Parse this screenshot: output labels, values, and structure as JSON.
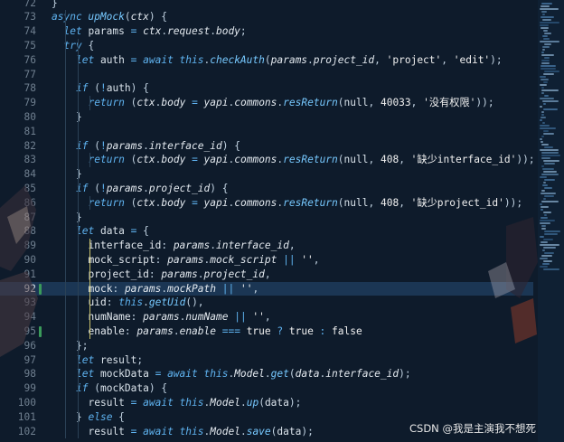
{
  "editor": {
    "current_line": "92",
    "lines": [
      {
        "n": "72",
        "indent": 1,
        "tokens": [
          [
            "pun",
            "}"
          ]
        ]
      },
      {
        "n": "73",
        "indent": 1,
        "tokens": [
          [
            "kw",
            "async "
          ],
          [
            "fn",
            "upMock"
          ],
          [
            "pun",
            "("
          ],
          [
            "var",
            "ctx"
          ],
          [
            "pun",
            ") {"
          ]
        ]
      },
      {
        "n": "74",
        "indent": 2,
        "tokens": [
          [
            "kw",
            "let "
          ],
          [
            "plain",
            "params "
          ],
          [
            "op",
            "= "
          ],
          [
            "var",
            "ctx"
          ],
          [
            "pun",
            "."
          ],
          [
            "var",
            "request"
          ],
          [
            "pun",
            "."
          ],
          [
            "var",
            "body"
          ],
          [
            "pun",
            ";"
          ]
        ]
      },
      {
        "n": "75",
        "indent": 2,
        "tokens": [
          [
            "kw",
            "try "
          ],
          [
            "pun",
            "{"
          ]
        ]
      },
      {
        "n": "76",
        "indent": 3,
        "tokens": [
          [
            "kw",
            "let "
          ],
          [
            "plain",
            "auth "
          ],
          [
            "op",
            "= "
          ],
          [
            "kw",
            "await "
          ],
          [
            "kw",
            "this"
          ],
          [
            "pun",
            "."
          ],
          [
            "fn",
            "checkAuth"
          ],
          [
            "pun",
            "("
          ],
          [
            "var",
            "params"
          ],
          [
            "pun",
            "."
          ],
          [
            "var",
            "project_id"
          ],
          [
            "pun",
            ", "
          ],
          [
            "str",
            "'project'"
          ],
          [
            "pun",
            ", "
          ],
          [
            "str",
            "'edit'"
          ],
          [
            "pun",
            ");"
          ]
        ]
      },
      {
        "n": "77",
        "indent": 3,
        "tokens": []
      },
      {
        "n": "78",
        "indent": 3,
        "tokens": [
          [
            "kw",
            "if "
          ],
          [
            "pun",
            "("
          ],
          [
            "op",
            "!"
          ],
          [
            "plain",
            "auth"
          ],
          [
            "pun",
            ") {"
          ]
        ]
      },
      {
        "n": "79",
        "indent": 4,
        "tokens": [
          [
            "kw",
            "return "
          ],
          [
            "pun",
            "("
          ],
          [
            "var",
            "ctx"
          ],
          [
            "pun",
            "."
          ],
          [
            "var",
            "body"
          ],
          [
            "op",
            " = "
          ],
          [
            "var",
            "yapi"
          ],
          [
            "pun",
            "."
          ],
          [
            "var",
            "commons"
          ],
          [
            "pun",
            "."
          ],
          [
            "fn",
            "resReturn"
          ],
          [
            "pun",
            "("
          ],
          [
            "plain",
            "null"
          ],
          [
            "pun",
            ", "
          ],
          [
            "num",
            "40033"
          ],
          [
            "pun",
            ", "
          ],
          [
            "str",
            "'没有权限'"
          ],
          [
            "pun",
            "));"
          ]
        ]
      },
      {
        "n": "80",
        "indent": 3,
        "tokens": [
          [
            "pun",
            "}"
          ]
        ]
      },
      {
        "n": "81",
        "indent": 3,
        "tokens": []
      },
      {
        "n": "82",
        "indent": 3,
        "tokens": [
          [
            "kw",
            "if "
          ],
          [
            "pun",
            "("
          ],
          [
            "op",
            "!"
          ],
          [
            "var",
            "params"
          ],
          [
            "pun",
            "."
          ],
          [
            "var",
            "interface_id"
          ],
          [
            "pun",
            ") {"
          ]
        ]
      },
      {
        "n": "83",
        "indent": 4,
        "tokens": [
          [
            "kw",
            "return "
          ],
          [
            "pun",
            "("
          ],
          [
            "var",
            "ctx"
          ],
          [
            "pun",
            "."
          ],
          [
            "var",
            "body"
          ],
          [
            "op",
            " = "
          ],
          [
            "var",
            "yapi"
          ],
          [
            "pun",
            "."
          ],
          [
            "var",
            "commons"
          ],
          [
            "pun",
            "."
          ],
          [
            "fn",
            "resReturn"
          ],
          [
            "pun",
            "("
          ],
          [
            "plain",
            "null"
          ],
          [
            "pun",
            ", "
          ],
          [
            "num",
            "408"
          ],
          [
            "pun",
            ", "
          ],
          [
            "str",
            "'缺少interface_id'"
          ],
          [
            "pun",
            "));"
          ]
        ]
      },
      {
        "n": "84",
        "indent": 3,
        "tokens": [
          [
            "pun",
            "}"
          ]
        ]
      },
      {
        "n": "85",
        "indent": 3,
        "tokens": [
          [
            "kw",
            "if "
          ],
          [
            "pun",
            "("
          ],
          [
            "op",
            "!"
          ],
          [
            "var",
            "params"
          ],
          [
            "pun",
            "."
          ],
          [
            "var",
            "project_id"
          ],
          [
            "pun",
            ") {"
          ]
        ]
      },
      {
        "n": "86",
        "indent": 4,
        "tokens": [
          [
            "kw",
            "return "
          ],
          [
            "pun",
            "("
          ],
          [
            "var",
            "ctx"
          ],
          [
            "pun",
            "."
          ],
          [
            "var",
            "body"
          ],
          [
            "op",
            " = "
          ],
          [
            "var",
            "yapi"
          ],
          [
            "pun",
            "."
          ],
          [
            "var",
            "commons"
          ],
          [
            "pun",
            "."
          ],
          [
            "fn",
            "resReturn"
          ],
          [
            "pun",
            "("
          ],
          [
            "plain",
            "null"
          ],
          [
            "pun",
            ", "
          ],
          [
            "num",
            "408"
          ],
          [
            "pun",
            ", "
          ],
          [
            "str",
            "'缺少project_id'"
          ],
          [
            "pun",
            "));"
          ]
        ]
      },
      {
        "n": "87",
        "indent": 3,
        "tokens": [
          [
            "pun",
            "}"
          ]
        ]
      },
      {
        "n": "88",
        "indent": 3,
        "tokens": [
          [
            "kw",
            "let "
          ],
          [
            "plain",
            "data "
          ],
          [
            "op",
            "= "
          ],
          [
            "pun",
            "{"
          ]
        ]
      },
      {
        "n": "89",
        "indent": 4,
        "tokens": [
          [
            "prop",
            "interface_id"
          ],
          [
            "pun",
            ": "
          ],
          [
            "var",
            "params"
          ],
          [
            "pun",
            "."
          ],
          [
            "var",
            "interface_id"
          ],
          [
            "pun",
            ","
          ]
        ]
      },
      {
        "n": "90",
        "indent": 4,
        "tokens": [
          [
            "prop",
            "mock_script"
          ],
          [
            "pun",
            ": "
          ],
          [
            "var",
            "params"
          ],
          [
            "pun",
            "."
          ],
          [
            "var",
            "mock_script"
          ],
          [
            "op",
            " || "
          ],
          [
            "str",
            "''"
          ],
          [
            "pun",
            ","
          ]
        ]
      },
      {
        "n": "91",
        "indent": 4,
        "tokens": [
          [
            "prop",
            "project_id"
          ],
          [
            "pun",
            ": "
          ],
          [
            "var",
            "params"
          ],
          [
            "pun",
            "."
          ],
          [
            "var",
            "project_id"
          ],
          [
            "pun",
            ","
          ]
        ]
      },
      {
        "n": "92",
        "indent": 4,
        "tokens": [
          [
            "prop",
            "mock"
          ],
          [
            "pun",
            ": "
          ],
          [
            "var",
            "params"
          ],
          [
            "pun",
            "."
          ],
          [
            "var",
            "mockPath"
          ],
          [
            "op",
            " || "
          ],
          [
            "str",
            "''"
          ],
          [
            "pun",
            ","
          ]
        ]
      },
      {
        "n": "93",
        "indent": 4,
        "tokens": [
          [
            "prop",
            "uid"
          ],
          [
            "pun",
            ": "
          ],
          [
            "kw",
            "this"
          ],
          [
            "pun",
            "."
          ],
          [
            "fn",
            "getUid"
          ],
          [
            "pun",
            "(),"
          ]
        ]
      },
      {
        "n": "94",
        "indent": 4,
        "tokens": [
          [
            "prop",
            "numName"
          ],
          [
            "pun",
            ": "
          ],
          [
            "var",
            "params"
          ],
          [
            "pun",
            "."
          ],
          [
            "var",
            "numName"
          ],
          [
            "op",
            " || "
          ],
          [
            "str",
            "''"
          ],
          [
            "pun",
            ","
          ]
        ]
      },
      {
        "n": "95",
        "indent": 4,
        "tokens": [
          [
            "prop",
            "enable"
          ],
          [
            "pun",
            ": "
          ],
          [
            "var",
            "params"
          ],
          [
            "pun",
            "."
          ],
          [
            "var",
            "enable"
          ],
          [
            "op",
            " === "
          ],
          [
            "bool",
            "true"
          ],
          [
            "op",
            " ? "
          ],
          [
            "bool",
            "true"
          ],
          [
            "op",
            " : "
          ],
          [
            "bool",
            "false"
          ]
        ]
      },
      {
        "n": "96",
        "indent": 3,
        "tokens": [
          [
            "pun",
            "};"
          ]
        ]
      },
      {
        "n": "97",
        "indent": 3,
        "tokens": [
          [
            "kw",
            "let "
          ],
          [
            "plain",
            "result"
          ],
          [
            "pun",
            ";"
          ]
        ]
      },
      {
        "n": "98",
        "indent": 3,
        "tokens": [
          [
            "kw",
            "let "
          ],
          [
            "plain",
            "mockData "
          ],
          [
            "op",
            "= "
          ],
          [
            "kw",
            "await "
          ],
          [
            "kw",
            "this"
          ],
          [
            "pun",
            "."
          ],
          [
            "var",
            "Model"
          ],
          [
            "pun",
            "."
          ],
          [
            "fn",
            "get"
          ],
          [
            "pun",
            "("
          ],
          [
            "var",
            "data"
          ],
          [
            "pun",
            "."
          ],
          [
            "var",
            "interface_id"
          ],
          [
            "pun",
            ");"
          ]
        ]
      },
      {
        "n": "99",
        "indent": 3,
        "tokens": [
          [
            "kw",
            "if "
          ],
          [
            "pun",
            "("
          ],
          [
            "plain",
            "mockData"
          ],
          [
            "pun",
            ") {"
          ]
        ]
      },
      {
        "n": "100",
        "indent": 4,
        "tokens": [
          [
            "plain",
            "result "
          ],
          [
            "op",
            "= "
          ],
          [
            "kw",
            "await "
          ],
          [
            "kw",
            "this"
          ],
          [
            "pun",
            "."
          ],
          [
            "var",
            "Model"
          ],
          [
            "pun",
            "."
          ],
          [
            "fn",
            "up"
          ],
          [
            "pun",
            "("
          ],
          [
            "plain",
            "data"
          ],
          [
            "pun",
            ");"
          ]
        ]
      },
      {
        "n": "101",
        "indent": 3,
        "tokens": [
          [
            "pun",
            "} "
          ],
          [
            "kw",
            "else "
          ],
          [
            "pun",
            "{"
          ]
        ]
      },
      {
        "n": "102",
        "indent": 4,
        "tokens": [
          [
            "plain",
            "result "
          ],
          [
            "op",
            "= "
          ],
          [
            "kw",
            "await "
          ],
          [
            "kw",
            "this"
          ],
          [
            "pun",
            "."
          ],
          [
            "var",
            "Model"
          ],
          [
            "pun",
            "."
          ],
          [
            "fn",
            "save"
          ],
          [
            "pun",
            "("
          ],
          [
            "plain",
            "data"
          ],
          [
            "pun",
            ");"
          ]
        ]
      }
    ]
  },
  "watermark": "CSDN @我是主演我不想死",
  "colors": {
    "background": "#0e1b2b",
    "current_line": "#1b3654",
    "keyword": "#5fb3f0",
    "function": "#77c9ff"
  }
}
